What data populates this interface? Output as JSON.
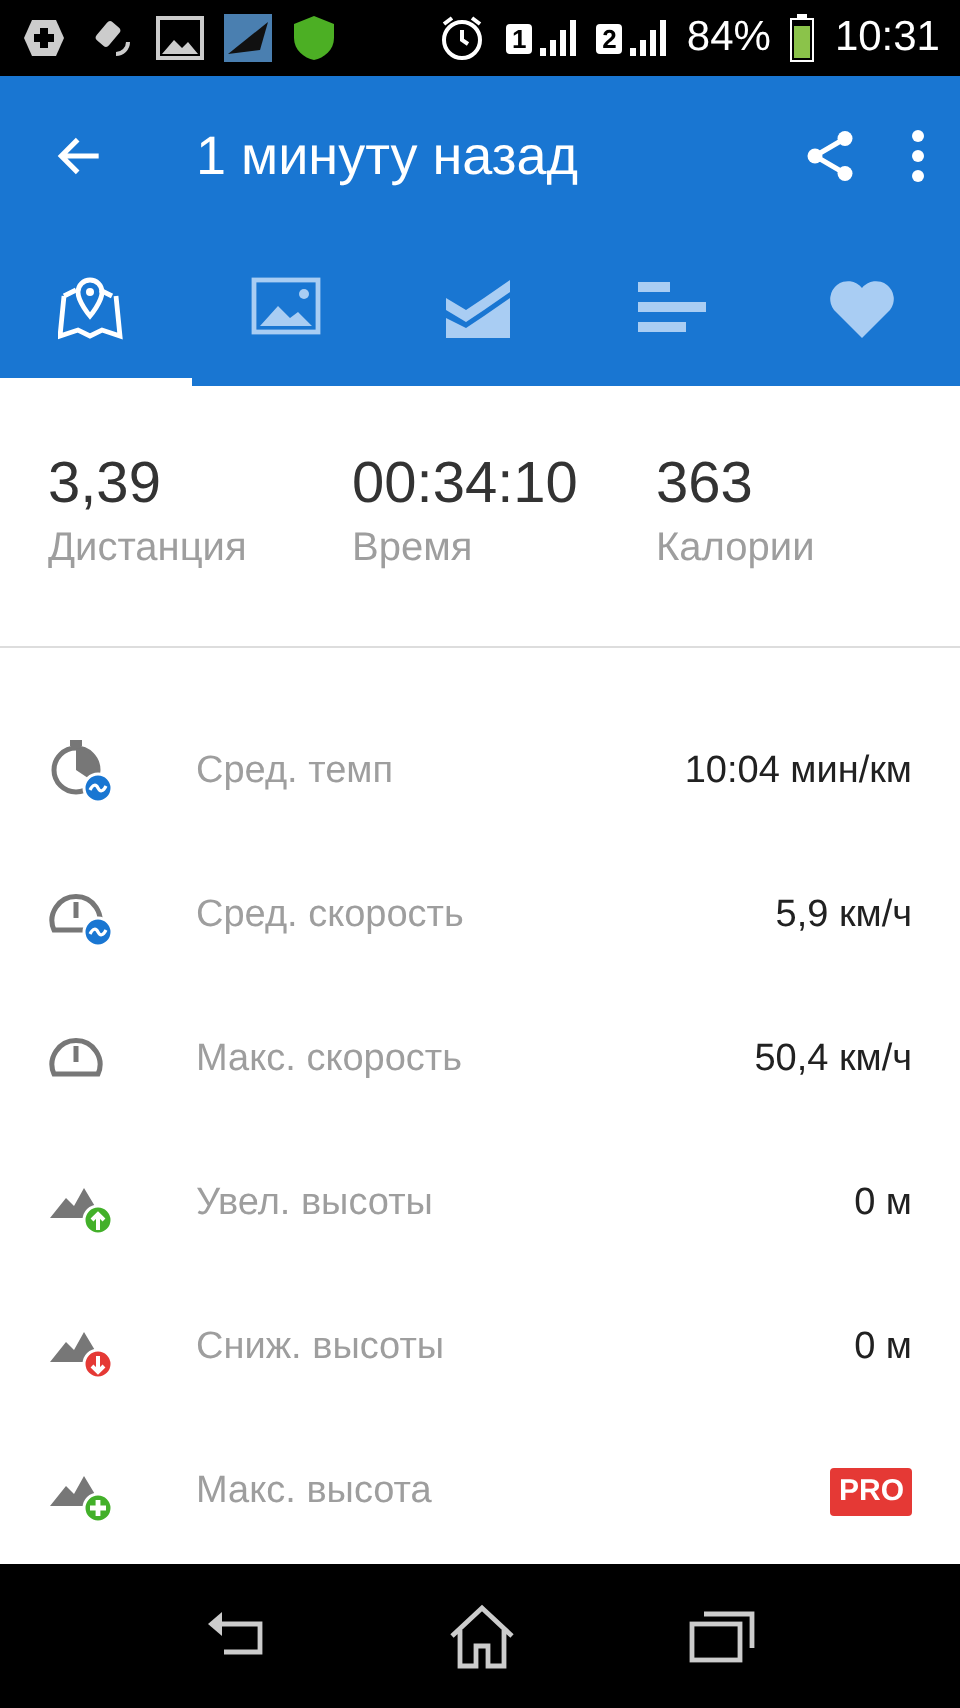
{
  "status_bar": {
    "sim_1": "1",
    "sim_2": "2",
    "battery_percent": "84%",
    "time": "10:31"
  },
  "app_bar": {
    "title": "1 минуту назад"
  },
  "tabs": [
    {
      "kind": "map",
      "selected": true
    },
    {
      "kind": "photo",
      "selected": false
    },
    {
      "kind": "chart",
      "selected": false
    },
    {
      "kind": "splits",
      "selected": false
    },
    {
      "kind": "heart",
      "selected": false
    }
  ],
  "summary": [
    {
      "value": "3,39",
      "label": "Дистанция"
    },
    {
      "value": "00:34:10",
      "label": "Время"
    },
    {
      "value": "363",
      "label": "Калории"
    }
  ],
  "metrics": [
    {
      "color": "#1976d2",
      "label": "Сред. темп",
      "kind": "value",
      "value": "10:04 мин/км"
    },
    {
      "color": "#1976d2",
      "label": "Сред. скорость",
      "kind": "value",
      "value": "5,9 км/ч"
    },
    {
      "label": "Макс. скорость",
      "kind": "value",
      "value": "50,4 км/ч"
    },
    {
      "color": "#43b02a",
      "label": "Увел. высоты",
      "kind": "value",
      "value": "0 м"
    },
    {
      "color": "#e53935",
      "label": "Сниж. высоты",
      "kind": "value",
      "value": "0 м"
    },
    {
      "color": "#43b02a",
      "label": "Макс. высота",
      "kind": "pro",
      "value": "PRO"
    }
  ]
}
